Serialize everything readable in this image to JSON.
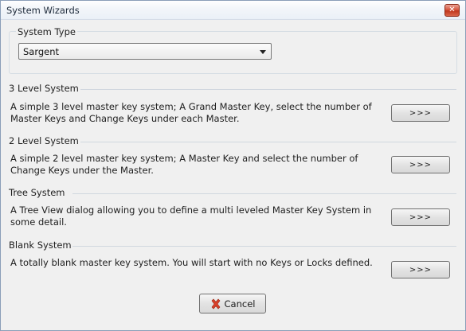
{
  "window": {
    "title": "System Wizards",
    "close_glyph": "✕"
  },
  "system_type": {
    "label": "System Type",
    "selected": "Sargent"
  },
  "sections": [
    {
      "title": "3 Level System",
      "description": "A simple 3 level master key system; A Grand Master Key, select the number of Master Keys and Change Keys under each Master.",
      "button_label": ">>>"
    },
    {
      "title": "2 Level System",
      "description": "A simple 2 level master key system; A Master Key and select the number of Change Keys under the Master.",
      "button_label": ">>>"
    },
    {
      "title": "Tree System",
      "description": "A Tree View dialog allowing you to define a multi leveled Master Key System in some detail.",
      "button_label": ">>>"
    },
    {
      "title": "Blank System",
      "description": "A totally blank master key system. You will start with no Keys or Locks defined.",
      "button_label": ">>>"
    }
  ],
  "footer": {
    "cancel_label": "Cancel",
    "cancel_icon": "red-x-icon"
  },
  "colors": {
    "close_button": "#c0391f",
    "cancel_icon": "#d9412b"
  }
}
